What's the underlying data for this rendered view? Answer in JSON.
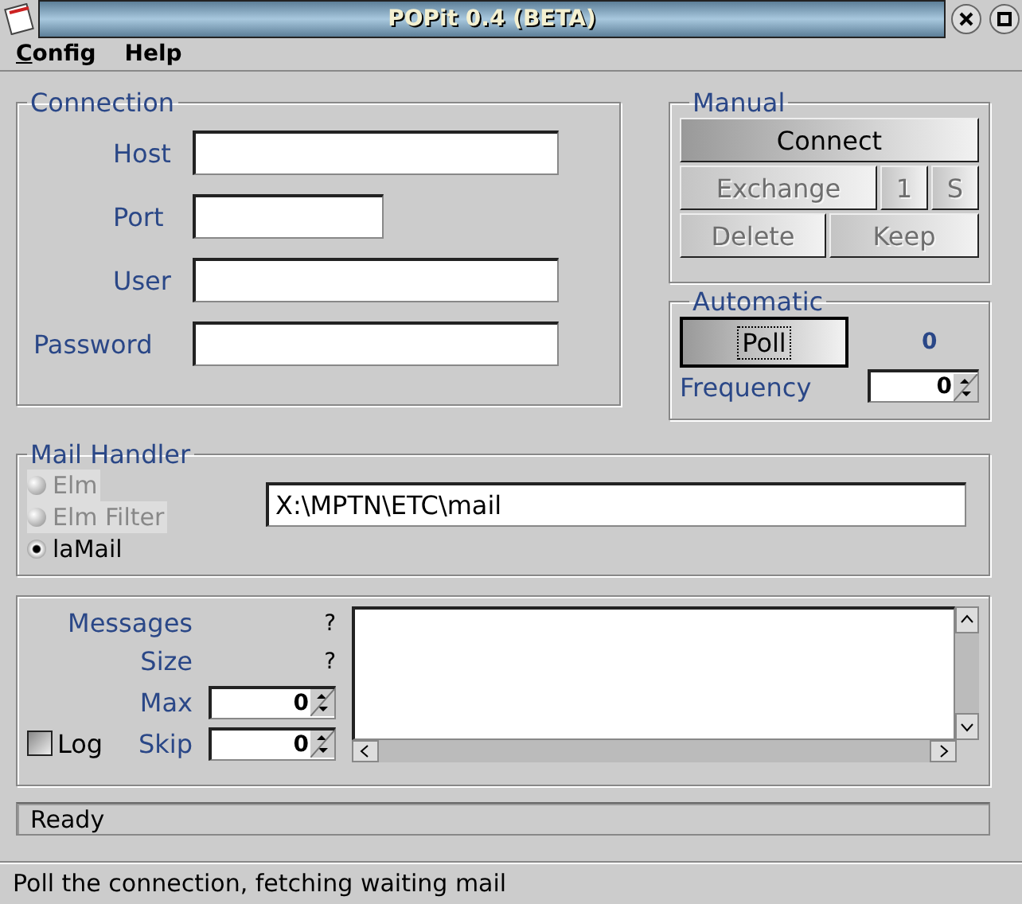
{
  "window": {
    "title": "POPit 0.4 (BETA)"
  },
  "menu": [
    {
      "label": "Config",
      "underline_first": true
    },
    {
      "label": "Help",
      "underline_first": false
    }
  ],
  "connection": {
    "title": "Connection",
    "fields": [
      {
        "label": "Host",
        "kind": "wide"
      },
      {
        "label": "Port",
        "kind": "short"
      },
      {
        "label": "User",
        "kind": "wide"
      },
      {
        "label": "Password",
        "kind": "wide"
      }
    ]
  },
  "manual": {
    "title": "Manual",
    "buttons": [
      {
        "label": "Connect",
        "disabled": false
      },
      {
        "label": "Exchange",
        "disabled": true
      },
      {
        "label": "1",
        "disabled": true
      },
      {
        "label": "S",
        "disabled": true
      },
      {
        "label": "Delete",
        "disabled": true
      },
      {
        "label": "Keep",
        "disabled": true
      }
    ]
  },
  "automatic": {
    "title": "Automatic",
    "poll": {
      "label": "Poll",
      "focused": true
    },
    "count": "0",
    "frequency_label": "Frequency",
    "frequency": "0"
  },
  "mail_handler": {
    "title": "Mail Handler",
    "options": [
      {
        "label": "Elm",
        "selected": false,
        "disabled": true
      },
      {
        "label": "Elm Filter",
        "selected": false,
        "disabled": true
      },
      {
        "label": "laMail",
        "selected": true,
        "disabled": false
      }
    ],
    "path": "X:\\MPTN\\ETC\\mail"
  },
  "stats": {
    "messages_label": "Messages",
    "messages": "?",
    "size_label": "Size",
    "size": "?",
    "max_label": "Max",
    "max": "0",
    "skip_label": "Skip",
    "skip": "0",
    "log": {
      "label": "Log",
      "checked": false
    }
  },
  "progress": "Ready",
  "status_bar": "Poll the connection, fetching waiting mail"
}
